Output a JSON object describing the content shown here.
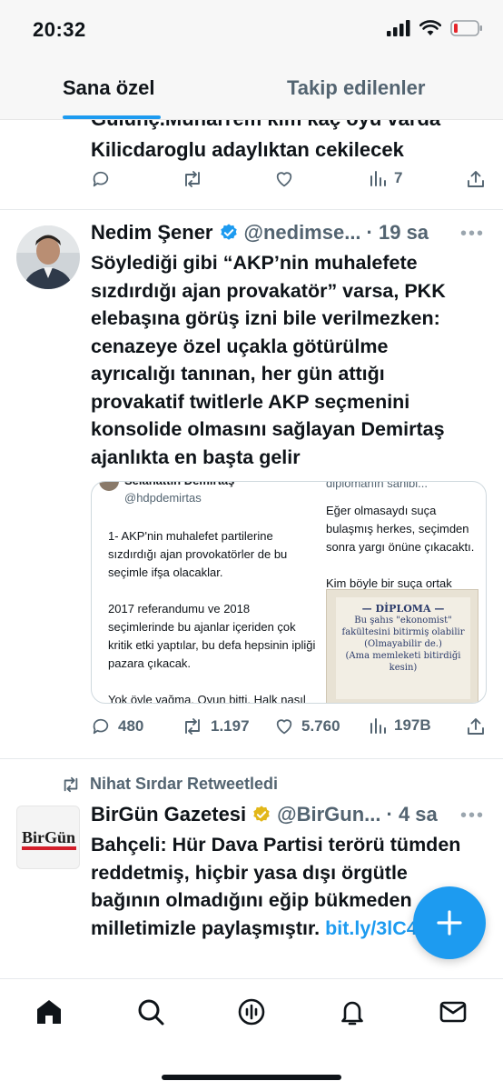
{
  "status_bar": {
    "time": "20:32"
  },
  "tabs": [
    {
      "label": "Sana özel",
      "active": true
    },
    {
      "label": "Takip edilenler",
      "active": false
    }
  ],
  "previous_tweet": {
    "text_line_1": "Gulunç.Muharrem kim kaç oyu varda",
    "text_line_2": "Kilicdaroglu adaylıktan cekilecek",
    "views": "7"
  },
  "tweet": {
    "author_name": "Nedim Şener",
    "handle": "@nedimse...",
    "time": "· 19 sa",
    "text": "Söylediği gibi “AKP’nin muhalefete sızdırdığı ajan provakatör” varsa, PKK elebaşına görüş izni bile verilmezken: cenazeye özel uçakla götürülme ayrıcalığı tanınan, her gün attığı provakatif twitlerle AKP seçmenini konsolide olmasını sağlayan Demirtaş ajanlıkta en başta gelir",
    "quote": {
      "name": "Selahattin Demirtaş",
      "handle": "@hdpdemirtas",
      "para1": "1- AKP'nin muhalefet partilerine sızdırdığı ajan provokatörler de bu seçimle ifşa olacaklar.",
      "para2": "2017 referandumu ve 2018 seçimlerinde bu ajanlar içeriden çok kritik etki yaptılar, bu defa hepsinin ipliği pazara çıkacak.",
      "para3": "Yok öyle yağma. Oyun bitti. Halk nasıl istiyorsa öyle olacak.",
      "right_top": "diplomanın sahibi...",
      "right_para1": "Eğer olmasaydı suça bulaşmış herkes, seçimden sonra yargı önüne çıkacaktı.",
      "right_para2": "Kim böyle bir suça ortak olmayı göze alabilir ki zaten!",
      "diploma_title": "— DİPLOMA —",
      "diploma_line1": "Bu şahıs \"ekonomist\"",
      "diploma_line2": "fakültesini bitirmiş olabilir",
      "diploma_line3": "(Olmayabilir de.)",
      "diploma_line4": "(Ama memleketi bitirdiği kesin)"
    },
    "replies": "480",
    "retweets": "1.197",
    "likes": "5.760",
    "views": "197B"
  },
  "retweeted_tweet": {
    "retweeted_by": "Nihat Sırdar Retweetledi",
    "logo_text": "BirGün",
    "author_name": "BirGün Gazetesi",
    "handle": "@BirGun...",
    "time": "· 4 sa",
    "text": "Bahçeli: Hür Dava Partisi terörü tümden reddetmiş, hiçbir yasa dışı örgütle bağının olmadığını eğip bükmeden milletimizle paylaşmıştır.",
    "link": "bit.ly/3lC4v7X"
  },
  "colors": {
    "accent": "#1d9bf0",
    "verified": "#1d9bf0",
    "gold_verified": "#e2b719",
    "muted": "#536471"
  },
  "bottom_nav": [
    "home-icon",
    "search-icon",
    "spaces-icon",
    "notifications-icon",
    "messages-icon"
  ]
}
